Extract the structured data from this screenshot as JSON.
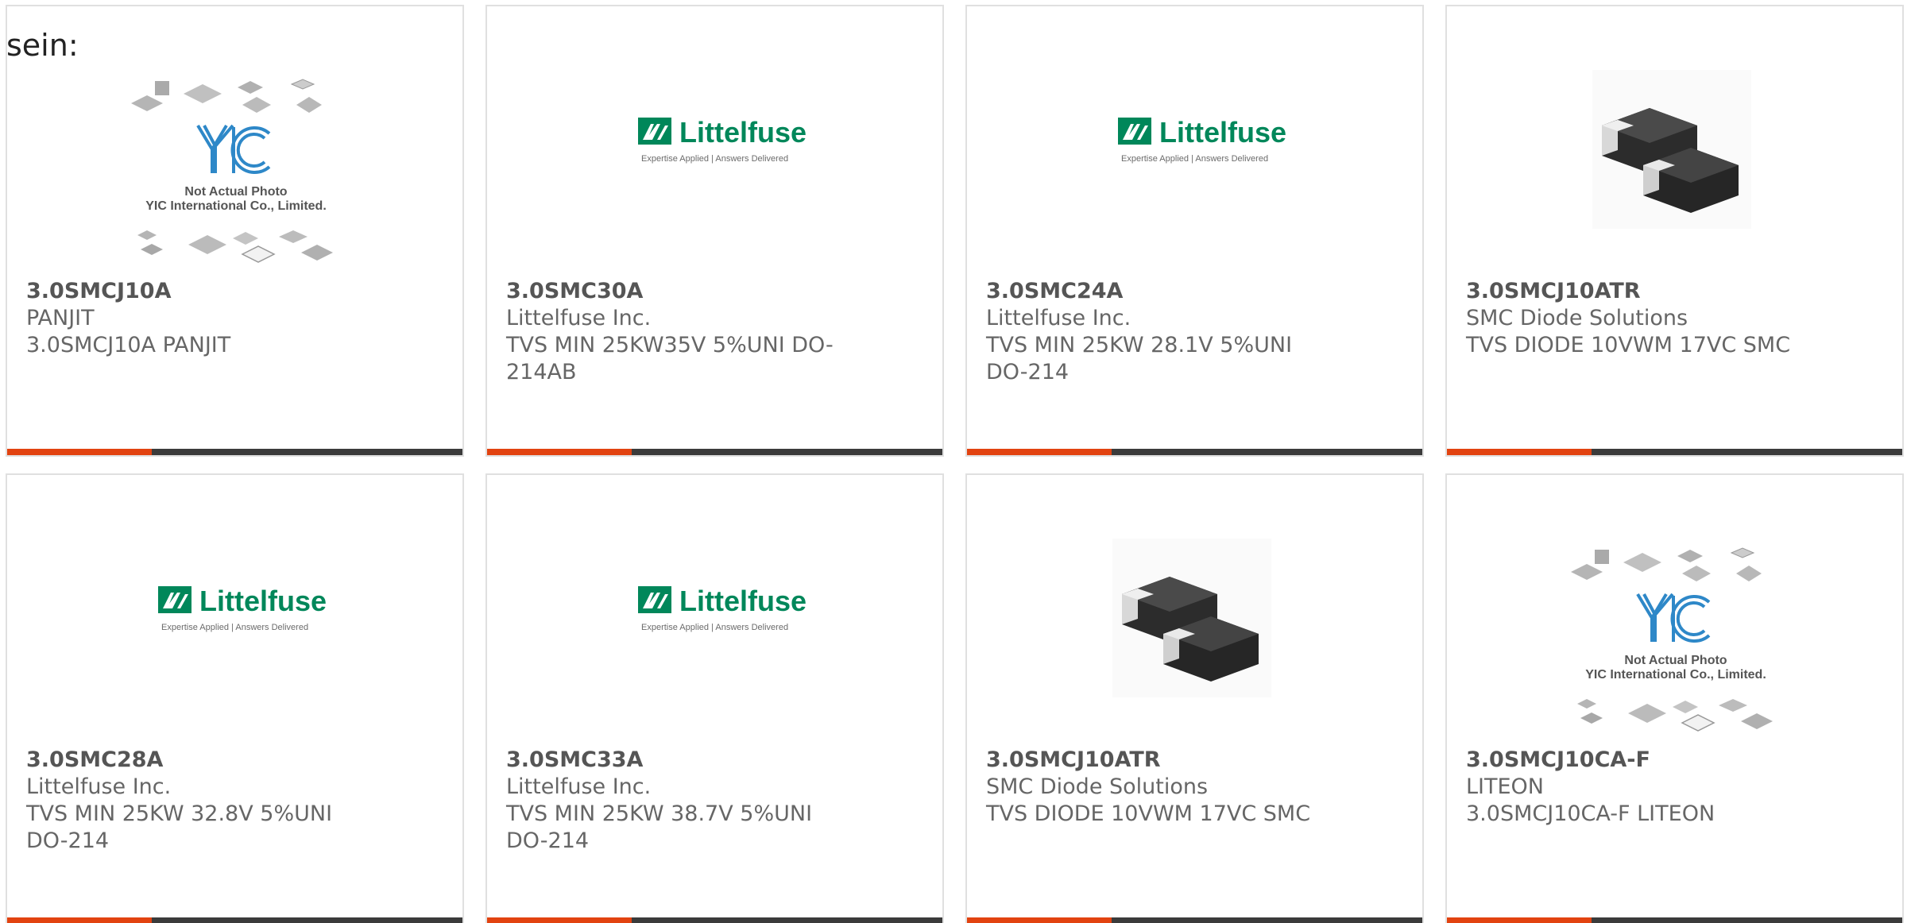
{
  "lead_text": "sein:",
  "colors": {
    "accent": "#e24310",
    "bar": "#3b3b3b",
    "card_border": "#e0e0e0",
    "littelfuse_green": "#00875a",
    "yic_blue": "#2e88c8"
  },
  "logos": {
    "littelfuse_name": "Littelfuse",
    "littelfuse_tagline": "Expertise Applied | Answers Delivered",
    "yic_mark": "YIC",
    "yic_line1": "Not Actual Photo",
    "yic_line2": "YIC International Co., Limited."
  },
  "products": [
    {
      "image": "yic-placeholder-icon",
      "part": "3.0SMCJ10A",
      "manufacturer": "PANJIT",
      "description": "3.0SMCJ10A PANJIT"
    },
    {
      "image": "littelfuse-logo-icon",
      "part": "3.0SMC30A",
      "manufacturer": "Littelfuse Inc.",
      "description": "TVS MIN 25KW35V 5%UNI DO-214AB"
    },
    {
      "image": "littelfuse-logo-icon",
      "part": "3.0SMC24A",
      "manufacturer": "Littelfuse Inc.",
      "description": "TVS MIN 25KW 28.1V 5%UNI DO-214"
    },
    {
      "image": "smc-diode-icon",
      "part": "3.0SMCJ10ATR",
      "manufacturer": "SMC Diode Solutions",
      "description": "TVS DIODE 10VWM 17VC SMC"
    },
    {
      "image": "littelfuse-logo-icon",
      "part": "3.0SMC28A",
      "manufacturer": "Littelfuse Inc.",
      "description": "TVS MIN 25KW 32.8V 5%UNI DO-214"
    },
    {
      "image": "littelfuse-logo-icon",
      "part": "3.0SMC33A",
      "manufacturer": "Littelfuse Inc.",
      "description": "TVS MIN 25KW 38.7V 5%UNI DO-214"
    },
    {
      "image": "smc-diode-icon",
      "part": "3.0SMCJ10ATR",
      "manufacturer": "SMC Diode Solutions",
      "description": "TVS DIODE 10VWM 17VC SMC"
    },
    {
      "image": "yic-placeholder-icon",
      "part": "3.0SMCJ10CA-F",
      "manufacturer": "LITEON",
      "description": "3.0SMCJ10CA-F LITEON"
    }
  ]
}
